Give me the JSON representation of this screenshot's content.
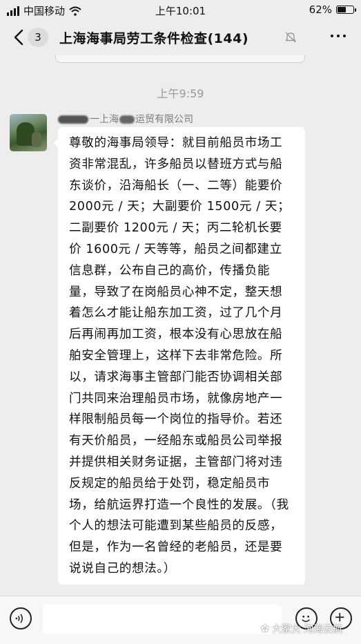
{
  "status": {
    "carrier": "中国移动",
    "time": "上午10:01",
    "battery": "62%",
    "battery_level": 0.62
  },
  "nav": {
    "unread_count": "3",
    "title": "上海海事局劳工条件检查(144)"
  },
  "chat": {
    "timestamp": "上午9:59",
    "sender": "一上海",
    "sender_suffix": "运贸有限公司",
    "message": "尊敬的海事局领导：就目前船员市场工资非常混乱，许多船员以替班方式与船东谈价，沿海船长（一、二等）能要价 2000元 / 天；大副要价 1500元 / 天；二副要价 1200元 / 天；丙二轮机长要价 1600元 / 天等等，船员之间都建立信息群，公布自己的高价，传播负能量，导致了在岗船员心神不定，整天想着怎么才能让船东加工资，过了几个月后再闹再加工资，根本没有心思放在船舶安全管理上，这样下去非常危险。所以，请求海事主管部门能否协调相关部门共同来治理船员市场，就像房地产一样限制船员每一个岗位的指导价。若还有天价船员，一经船东或船员公司举报并提供相关财务证据，主管部门将对违反规定的船员给于处罚，稳定船员市场，给航运界打造一个良性的发展。（我个人的想法可能遭到某些船员的反感，但是，作为一名曾经的老船员，还是要说说自己的想法。）"
  },
  "watermark": {
    "text": "大家大  洵海云航"
  }
}
